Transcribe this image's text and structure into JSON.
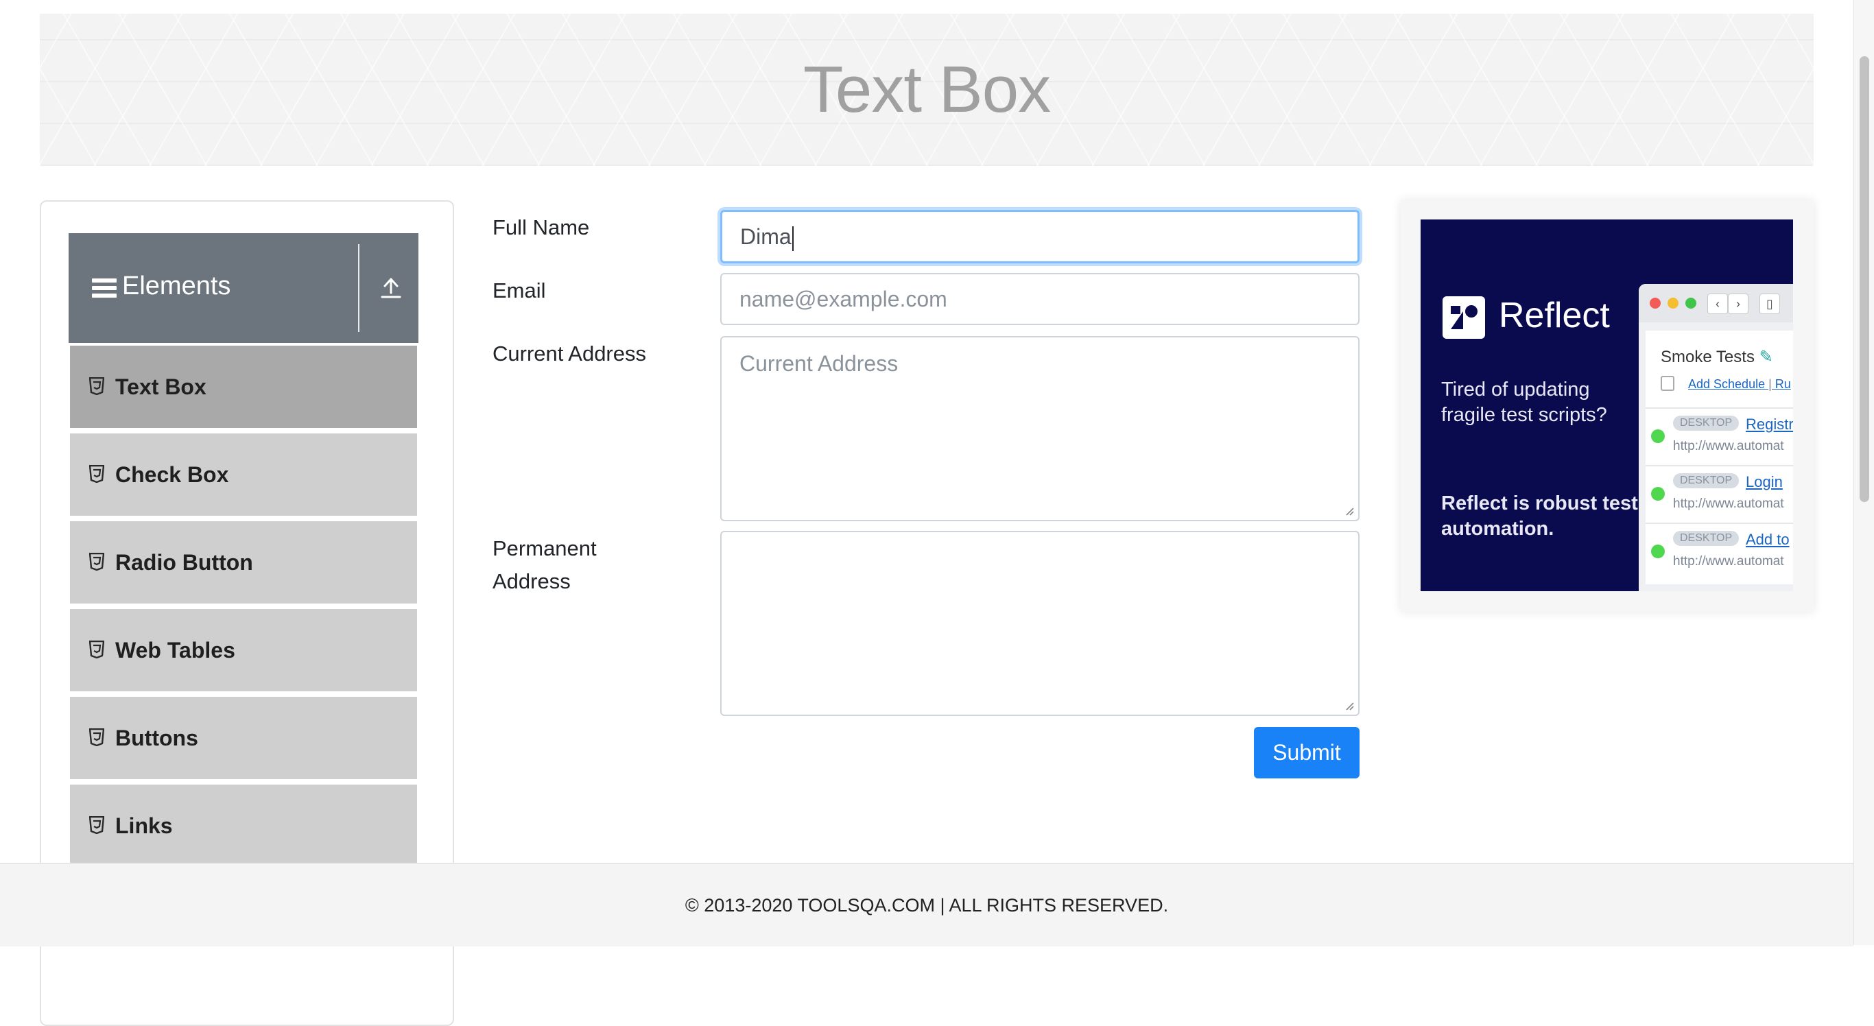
{
  "page": {
    "title": "Text Box"
  },
  "sidebar": {
    "group_title": "Elements",
    "items": [
      {
        "label": "Text Box",
        "active": true
      },
      {
        "label": "Check Box"
      },
      {
        "label": "Radio Button"
      },
      {
        "label": "Web Tables"
      },
      {
        "label": "Buttons"
      },
      {
        "label": "Links"
      }
    ]
  },
  "form": {
    "full_name": {
      "label": "Full Name",
      "value": "Dima"
    },
    "email": {
      "label": "Email",
      "placeholder": "name@example.com"
    },
    "current_address": {
      "label": "Current Address",
      "placeholder": "Current Address"
    },
    "permanent_address": {
      "label": "Permanent Address",
      "value": ""
    },
    "submit_label": "Submit"
  },
  "ad": {
    "brand": "Reflect",
    "tagline": "Tired of updating fragile test scripts?",
    "tagline_bold": "Reflect is robust test automation.",
    "panel_title": "Smoke Tests",
    "schedule_link": "Add Schedule",
    "schedule_link_2": "Ru",
    "rows": [
      {
        "badge": "DESKTOP",
        "link": "Registr",
        "url": "http://www.automat"
      },
      {
        "badge": "DESKTOP",
        "link": "Login",
        "url": "http://www.automat"
      },
      {
        "badge": "DESKTOP",
        "link": "Add to",
        "url": "http://www.automat"
      }
    ]
  },
  "footer": {
    "text": "© 2013-2020 TOOLSQA.COM | ALL RIGHTS RESERVED."
  },
  "colors": {
    "sidebar_header": "#6c757d",
    "primary": "#1a82f7",
    "ad_bg": "#0a0b4f"
  }
}
